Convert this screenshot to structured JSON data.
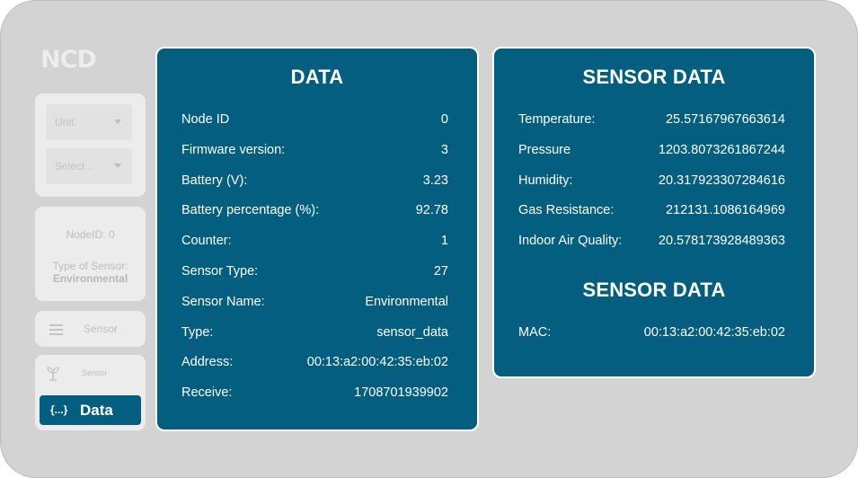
{
  "brand": {
    "logo_text": "NCD"
  },
  "sidebar": {
    "unit_select": {
      "value": "Unit:"
    },
    "node_select": {
      "value": "Select..."
    },
    "node_info": {
      "node_id": "NodeID: 0",
      "sensor_type_label": "Type of Sensor:",
      "sensor_type_value": "Environmental"
    },
    "sensor_button": {
      "label": "Sensor"
    },
    "sensor_small": {
      "label": "Sensor"
    },
    "data_button": {
      "icon_text": "{...}",
      "label": "Data"
    }
  },
  "data_panel": {
    "title": "DATA",
    "rows": [
      {
        "label": "Node ID",
        "value": "0"
      },
      {
        "label": "Firmware version:",
        "value": "3"
      },
      {
        "label": "Battery (V):",
        "value": "3.23"
      },
      {
        "label": "Battery percentage (%):",
        "value": "92.78"
      },
      {
        "label": "Counter:",
        "value": "1"
      },
      {
        "label": "Sensor Type:",
        "value": "27"
      },
      {
        "label": "Sensor Name:",
        "value": "Environmental"
      },
      {
        "label": "Type:",
        "value": "sensor_data"
      },
      {
        "label": "Address:",
        "value": "00:13:a2:00:42:35:eb:02"
      },
      {
        "label": "Receive:",
        "value": "1708701939902"
      }
    ]
  },
  "sensor_panel": {
    "title": "SENSOR DATA",
    "rows": [
      {
        "label": "Temperature:",
        "value": "25.57167967663614"
      },
      {
        "label": "Pressure",
        "value": "1203.8073261867244"
      },
      {
        "label": "Humidity:",
        "value": "20.317923307284616"
      },
      {
        "label": "Gas Resistance:",
        "value": "212131.1086164969"
      },
      {
        "label": "Indoor Air Quality:",
        "value": "20.578173928489363"
      }
    ],
    "title2": "SENSOR DATA",
    "rows2": [
      {
        "label": "MAC:",
        "value": "00:13:a2:00:42:35:eb:02"
      }
    ]
  },
  "colors": {
    "panel_bg": "#035e7f",
    "frame_bg": "#d3d3d3",
    "sidebar_card": "#ececec"
  }
}
